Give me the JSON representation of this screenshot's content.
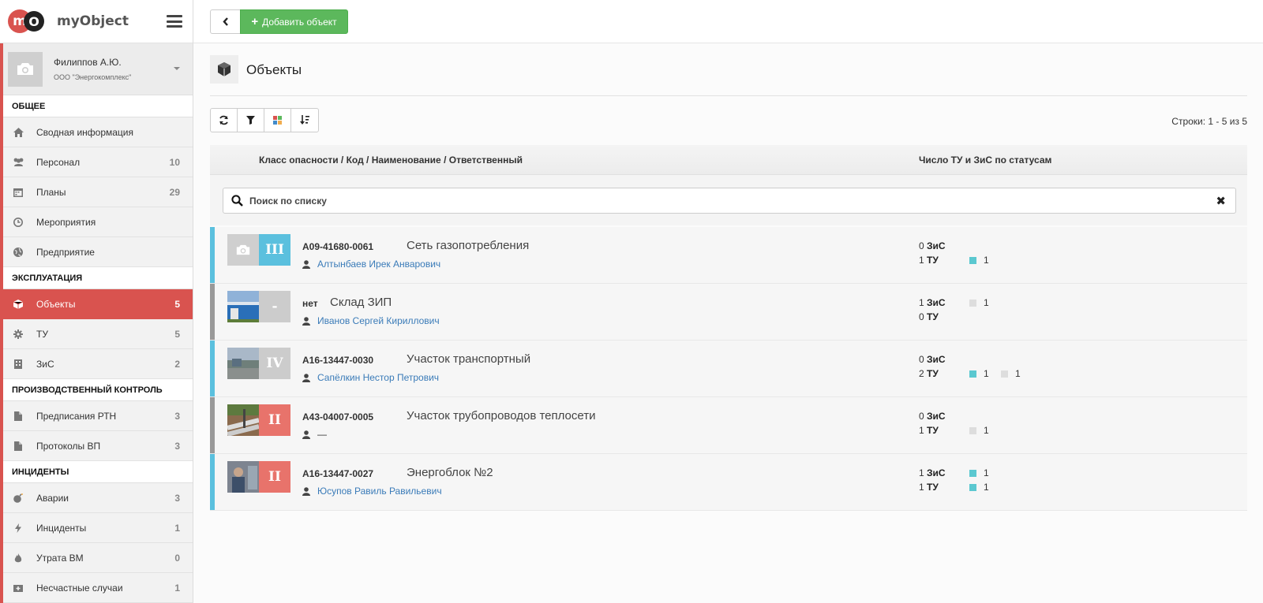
{
  "brand": {
    "logo_m": "m",
    "logo_o": "O",
    "name": "myObject"
  },
  "user": {
    "name": "Филиппов А.Ю.",
    "org": "ООО \"Энергокомплекс\""
  },
  "nav": {
    "sections": [
      {
        "title": "ОБЩЕЕ",
        "items": [
          {
            "label": "Сводная информация",
            "count": "",
            "icon": "home-icon",
            "active": false
          },
          {
            "label": "Персонал",
            "count": "10",
            "icon": "users-icon",
            "active": false
          },
          {
            "label": "Планы",
            "count": "29",
            "icon": "calendar-icon",
            "active": false
          },
          {
            "label": "Мероприятия",
            "count": "",
            "icon": "clock-icon",
            "active": false
          },
          {
            "label": "Предприятие",
            "count": "",
            "icon": "globe-icon",
            "active": false
          }
        ]
      },
      {
        "title": "ЭКСПЛУАТАЦИЯ",
        "items": [
          {
            "label": "Объекты",
            "count": "5",
            "icon": "cube-icon",
            "active": true
          },
          {
            "label": "ТУ",
            "count": "5",
            "icon": "gear-icon",
            "active": false
          },
          {
            "label": "ЗиС",
            "count": "2",
            "icon": "building-icon",
            "active": false
          }
        ]
      },
      {
        "title": "ПРОИЗВОДСТВЕННЫЙ КОНТРОЛЬ",
        "items": [
          {
            "label": "Предписания РТН",
            "count": "3",
            "icon": "document-icon",
            "active": false
          },
          {
            "label": "Протоколы ВП",
            "count": "3",
            "icon": "document-icon",
            "active": false
          }
        ]
      },
      {
        "title": "ИНЦИДЕНТЫ",
        "items": [
          {
            "label": "Аварии",
            "count": "3",
            "icon": "bomb-icon",
            "active": false
          },
          {
            "label": "Инциденты",
            "count": "1",
            "icon": "bolt-icon",
            "active": false
          },
          {
            "label": "Утрата ВМ",
            "count": "0",
            "icon": "fire-icon",
            "active": false
          },
          {
            "label": "Несчастные случаи",
            "count": "1",
            "icon": "medkit-icon",
            "active": false
          }
        ]
      }
    ]
  },
  "topbar": {
    "add_label": "Добавить объект"
  },
  "page": {
    "title": "Объекты",
    "rows_info": "Строки: 1 - 5 из 5"
  },
  "table": {
    "col1": "Класс опасности / Код / Наименование / Ответственный",
    "col2": "Число ТУ и ЗиС по статусам",
    "search_placeholder": "Поиск по списку",
    "label_zis": "ЗиС",
    "label_tu": "ТУ",
    "rows": [
      {
        "stripe": "#5bc0de",
        "photo": "placeholder",
        "cls": "III",
        "cls_color": "#5bc0de",
        "code": "А09-41680-0061",
        "name": "Сеть газопотребления",
        "resp": "Алтынбаев Ирек Анварович",
        "zis": "0",
        "tu": "1",
        "zis_chips": [],
        "tu_chips": [
          {
            "color": "#5bc8d0",
            "count": "1"
          }
        ]
      },
      {
        "stripe": "#999999",
        "photo": "warehouse",
        "cls": "-",
        "cls_color": "#cccccc",
        "code": "нет",
        "name": "Склад ЗИП",
        "resp": "Иванов Сергей Кириллович",
        "zis": "1",
        "tu": "0",
        "zis_chips": [
          {
            "color": "#dddddd",
            "count": "1"
          }
        ],
        "tu_chips": []
      },
      {
        "stripe": "#5bc0de",
        "photo": "yard",
        "cls": "IV",
        "cls_color": "#cccccc",
        "code": "А16-13447-0030",
        "name": "Участок транспортный",
        "resp": "Сапёлкин Нестор Петрович",
        "zis": "0",
        "tu": "2",
        "zis_chips": [],
        "tu_chips": [
          {
            "color": "#5bc8d0",
            "count": "1"
          },
          {
            "color": "#dddddd",
            "count": "1"
          }
        ]
      },
      {
        "stripe": "#999999",
        "photo": "pipes",
        "cls": "II",
        "cls_color": "#e8736b",
        "code": "А43-04007-0005",
        "name": "Участок трубопроводов теплосети",
        "resp": "—",
        "zis": "0",
        "tu": "1",
        "zis_chips": [],
        "tu_chips": [
          {
            "color": "#dddddd",
            "count": "1"
          }
        ]
      },
      {
        "stripe": "#5bc0de",
        "photo": "workers",
        "cls": "II",
        "cls_color": "#e8736b",
        "code": "А16-13447-0027",
        "name": "Энергоблок №2",
        "resp": "Юсупов Равиль Равильевич",
        "zis": "1",
        "tu": "1",
        "zis_chips": [
          {
            "color": "#5bc8d0",
            "count": "1"
          }
        ],
        "tu_chips": [
          {
            "color": "#5bc8d0",
            "count": "1"
          }
        ]
      }
    ]
  },
  "colors": {
    "accent": "#d9534f",
    "success": "#5cb85c",
    "link": "#3a7bb8"
  }
}
